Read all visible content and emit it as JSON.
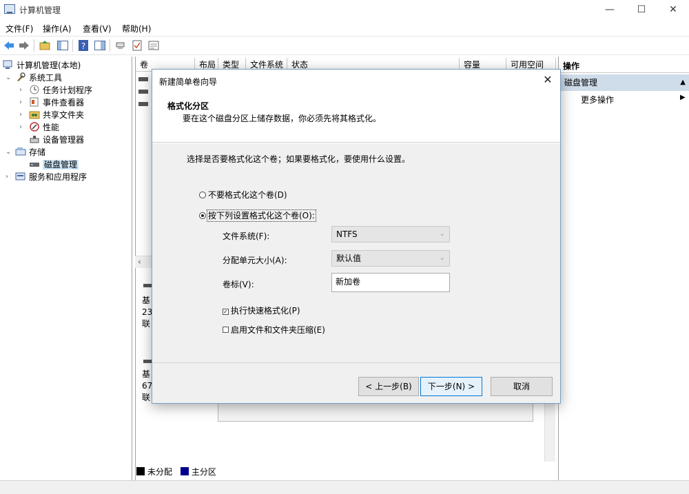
{
  "window": {
    "title": "计算机管理",
    "minimize": "—",
    "maximize": "☐",
    "close": "✕"
  },
  "menu": [
    "文件(F)",
    "操作(A)",
    "查看(V)",
    "帮助(H)"
  ],
  "tree": {
    "root": "计算机管理(本地)",
    "system_tools": "系统工具",
    "task_scheduler": "任务计划程序",
    "event_viewer": "事件查看器",
    "shared_folders": "共享文件夹",
    "performance": "性能",
    "device_manager": "设备管理器",
    "storage": "存储",
    "disk_management": "磁盘管理",
    "services_apps": "服务和应用程序"
  },
  "columns": [
    "卷",
    "布局",
    "类型",
    "文件系统",
    "状态",
    "容量",
    "可用空间"
  ],
  "disks": [
    {
      "line1": "基",
      "line2": "23",
      "line3": "联"
    },
    {
      "line1": "基",
      "line2": "67",
      "line3": "联"
    }
  ],
  "legend": {
    "unallocated": "未分配",
    "primary": "主分区"
  },
  "actions": {
    "header": "操作",
    "section": "磁盘管理",
    "more": "更多操作"
  },
  "dialog": {
    "title": "新建简单卷向导",
    "heading": "格式化分区",
    "subheading": "要在这个磁盘分区上储存数据，你必须先将其格式化。",
    "instruction": "选择是否要格式化这个卷；如果要格式化，要使用什么设置。",
    "no_format": "不要格式化这个卷(D)",
    "format_with": "按下列设置格式化这个卷(O):",
    "fs_label": "文件系统(F):",
    "fs_value": "NTFS",
    "alloc_label": "分配单元大小(A):",
    "alloc_value": "默认值",
    "vol_label": "卷标(V):",
    "vol_value": "新加卷",
    "quick_format": "执行快速格式化(P)",
    "compress": "启用文件和文件夹压缩(E)",
    "back": "< 上一步(B)",
    "next": "下一步(N) >",
    "cancel": "取消"
  },
  "colors": {
    "unallocated": "#000000",
    "primary": "#00008b",
    "selection": "#cce4f7",
    "accent": "#0078d7"
  }
}
